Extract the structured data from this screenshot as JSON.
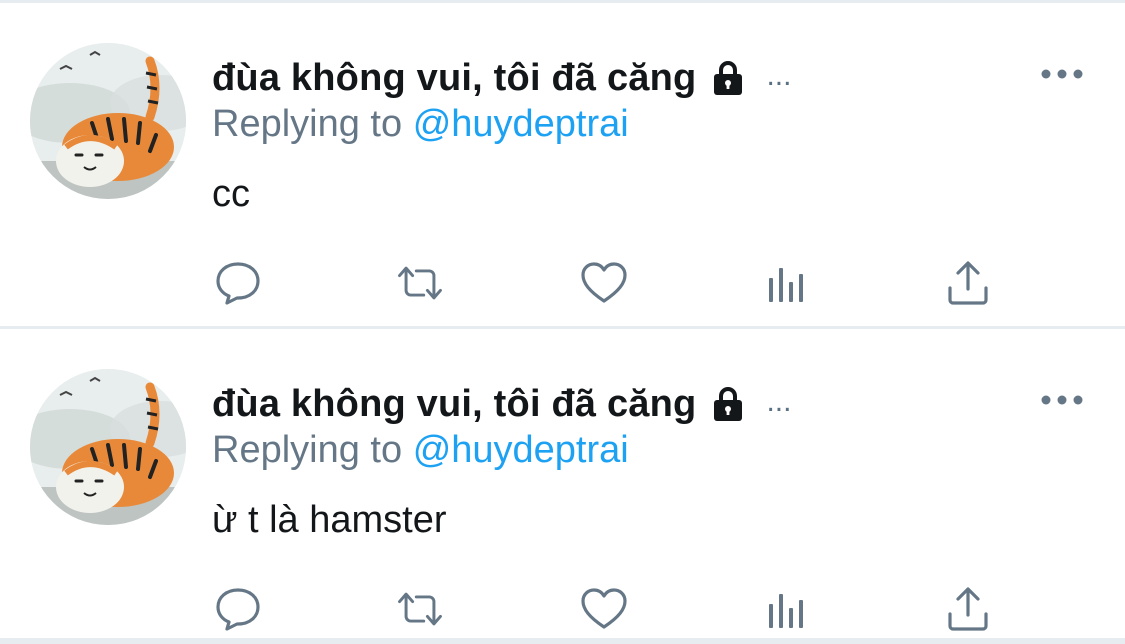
{
  "colors": {
    "name_text": "#14171a",
    "secondary_text": "#657786",
    "mention_link": "#1da1f2",
    "icon_gray": "#657786",
    "divider": "#e6ecf0"
  },
  "tweets": [
    {
      "display_name": "đùa không vui, tôi đã căng",
      "name_ellipsis": "...",
      "replying_prefix": "Replying to",
      "replying_handle": "@huydeptrai",
      "text": "cc",
      "icons": {
        "avatar": "tiger-avatar",
        "lock": "lock-icon",
        "more": "more-dots-icon",
        "reply": "reply-icon",
        "retweet": "retweet-icon",
        "like": "heart-icon",
        "analytics": "analytics-icon",
        "share": "share-icon"
      }
    },
    {
      "display_name": "đùa không vui, tôi đã căng",
      "name_ellipsis": "...",
      "replying_prefix": "Replying to",
      "replying_handle": "@huydeptrai",
      "text": "ừ t là hamster",
      "icons": {
        "avatar": "tiger-avatar",
        "lock": "lock-icon",
        "more": "more-dots-icon",
        "reply": "reply-icon",
        "retweet": "retweet-icon",
        "like": "heart-icon",
        "analytics": "analytics-icon",
        "share": "share-icon"
      }
    }
  ]
}
